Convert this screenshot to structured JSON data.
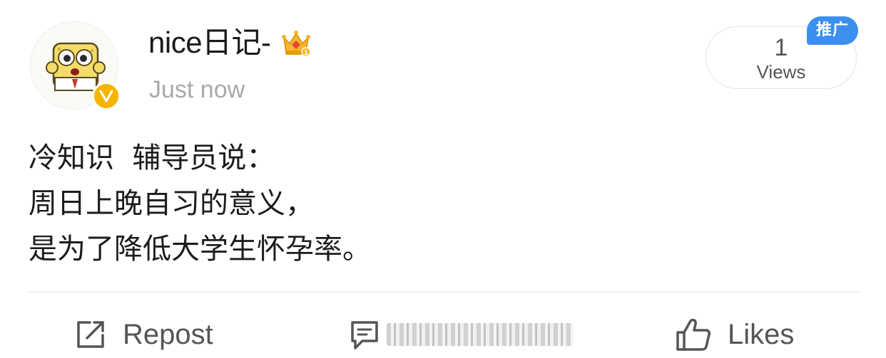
{
  "post": {
    "author": {
      "name": "nice日记-",
      "avatar_icon": "spongebob-avatar",
      "verified_icon": "verified-v-icon",
      "member_icon": "crown-icon",
      "verified_color": "#f6b400"
    },
    "timestamp": "Just now",
    "views": {
      "count": "1",
      "label": "Views"
    },
    "promo_badge": "推广",
    "promo_color": "#3d8fef",
    "content_lines": [
      "冷知识  辅导员说：",
      "周日上晚自习的意义，",
      "是为了降低大学生怀孕率。"
    ]
  },
  "actions": {
    "repost": {
      "label": "Repost",
      "icon": "repost-icon"
    },
    "comment": {
      "label": "",
      "icon": "comment-icon"
    },
    "likes": {
      "label": "Likes",
      "icon": "thumbs-up-icon"
    }
  }
}
